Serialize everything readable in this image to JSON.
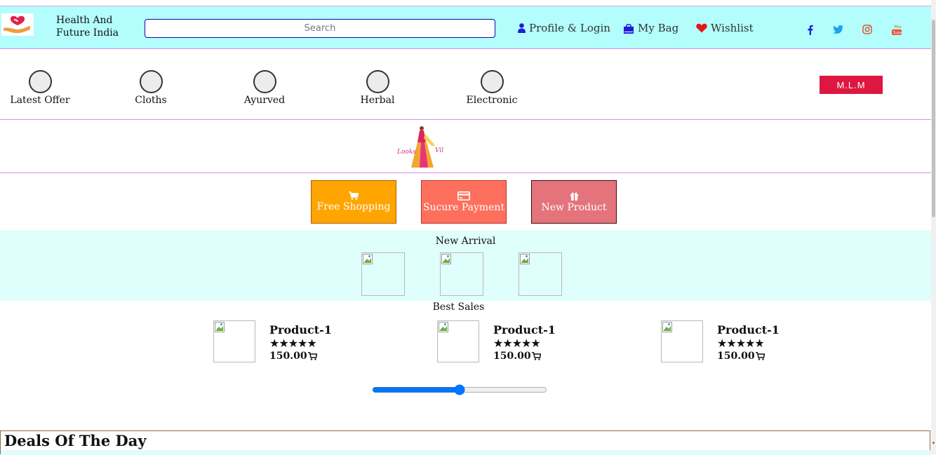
{
  "header": {
    "brand_line1": "Health And",
    "brand_line2": "Future India",
    "search_placeholder": "Search",
    "links": {
      "profile": "Profile & Login",
      "bag": "My Bag",
      "wishlist": "Wishlist"
    },
    "colors": {
      "background": "#b3fdfd",
      "icon_blue": "#1d1ddb",
      "heart_red": "#e8141b"
    }
  },
  "categories": [
    "Latest Offer",
    "Cloths",
    "Ayurved",
    "Herbal",
    "Electronic"
  ],
  "mlm_button": "M.L.M",
  "features": [
    {
      "label": "Free Shopping",
      "icon": "cart-icon",
      "color": "#ffa500"
    },
    {
      "label": "Sucure Payment",
      "icon": "credit-card-icon",
      "color": "#fe6f5e"
    },
    {
      "label": "New Product",
      "icon": "gift-icon",
      "color": "#e5737b"
    }
  ],
  "new_arrival": {
    "title": "New Arrival",
    "count_images": 3
  },
  "best_sales": {
    "title": "Best Sales",
    "products": [
      {
        "name": "Product-1",
        "rating": 5,
        "price": "150.00"
      },
      {
        "name": "Product-1",
        "rating": 5,
        "price": "150.00"
      },
      {
        "name": "Product-1",
        "rating": 5,
        "price": "150.00"
      }
    ]
  },
  "slider": {
    "value": 50,
    "min": 0,
    "max": 100
  },
  "deals": {
    "title": "Deals Of The Day"
  }
}
